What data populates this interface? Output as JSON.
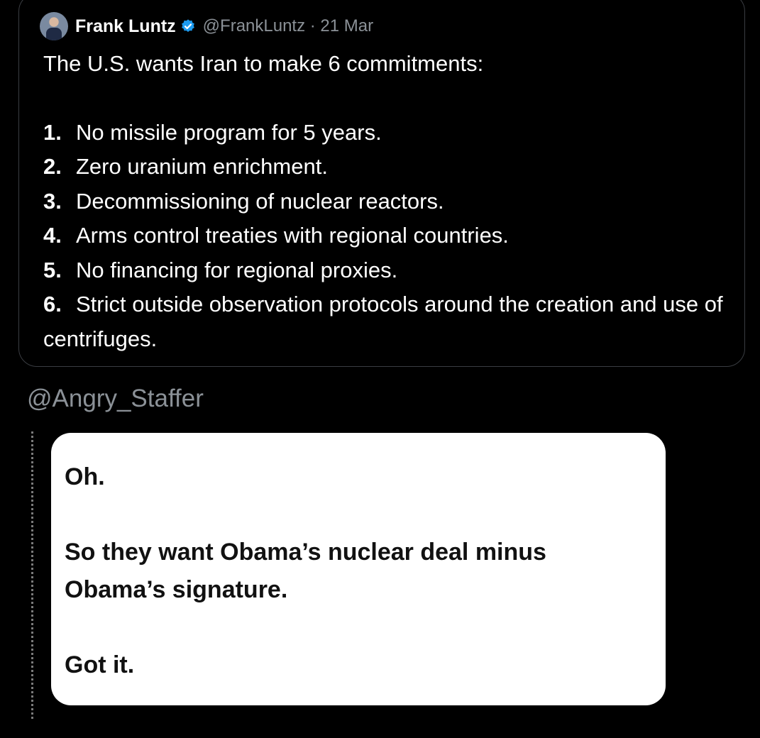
{
  "tweet": {
    "author": "Frank Luntz",
    "handle_date": "@FrankLuntz · 21 Mar",
    "intro": "The U.S. wants Iran to make 6 commitments:",
    "commitments": [
      {
        "num": "1.",
        "text": "No missile program for 5 years."
      },
      {
        "num": "2.",
        "text": "Zero uranium enrichment."
      },
      {
        "num": "3.",
        "text": "Decommissioning of nuclear reactors."
      },
      {
        "num": "4.",
        "text": "Arms control treaties with regional countries."
      },
      {
        "num": "5.",
        "text": "No financing for regional proxies."
      },
      {
        "num": "6.",
        "text": "Strict outside observation protocols around the creation and use of centrifuges."
      }
    ]
  },
  "retweeter": "@Angry_Staffer",
  "reply": {
    "line1": "Oh.",
    "line2": "So they want Obama’s nuclear deal minus Obama’s signature.",
    "line3": "Got it."
  },
  "colors": {
    "background": "#000000",
    "verified": "#1d9bf0",
    "muted_text": "#8b9197",
    "reply_card": "#ffffff"
  },
  "icons": {
    "verified": "verified-badge-icon",
    "avatar": "profile-avatar"
  }
}
